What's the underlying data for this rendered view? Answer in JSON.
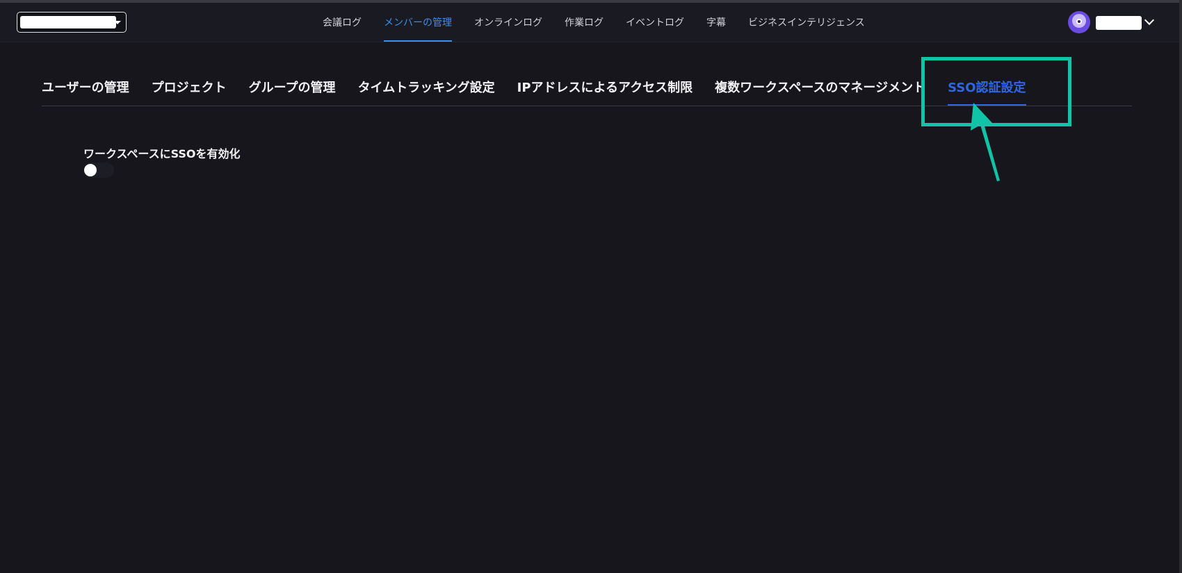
{
  "header": {
    "workspace_select": {
      "value": ""
    },
    "nav": [
      {
        "label": "会議ログ",
        "active": false
      },
      {
        "label": "メンバーの管理",
        "active": true
      },
      {
        "label": "オンラインログ",
        "active": false
      },
      {
        "label": "作業ログ",
        "active": false
      },
      {
        "label": "イベントログ",
        "active": false
      },
      {
        "label": "字幕",
        "active": false
      },
      {
        "label": "ビジネスインテリジェンス",
        "active": false
      }
    ],
    "user": {
      "name": "",
      "icon": "avatar-icon"
    }
  },
  "tabs": [
    {
      "label": "ユーザーの管理",
      "active": false
    },
    {
      "label": "プロジェクト",
      "active": false
    },
    {
      "label": "グループの管理",
      "active": false
    },
    {
      "label": "タイムトラッキング設定",
      "active": false
    },
    {
      "label": "IPアドレスによるアクセス制限",
      "active": false
    },
    {
      "label": "複数ワークスペースのマネージメント",
      "active": false
    },
    {
      "label": "SSO認証設定",
      "active": true
    }
  ],
  "sso": {
    "label": "ワークスペースにSSOを有効化",
    "enabled": false
  },
  "annotation": {
    "color": "#10c4a8"
  },
  "colors": {
    "background": "#16161c",
    "accent": "#3b8eea",
    "tab_active": "#2f66e6"
  }
}
